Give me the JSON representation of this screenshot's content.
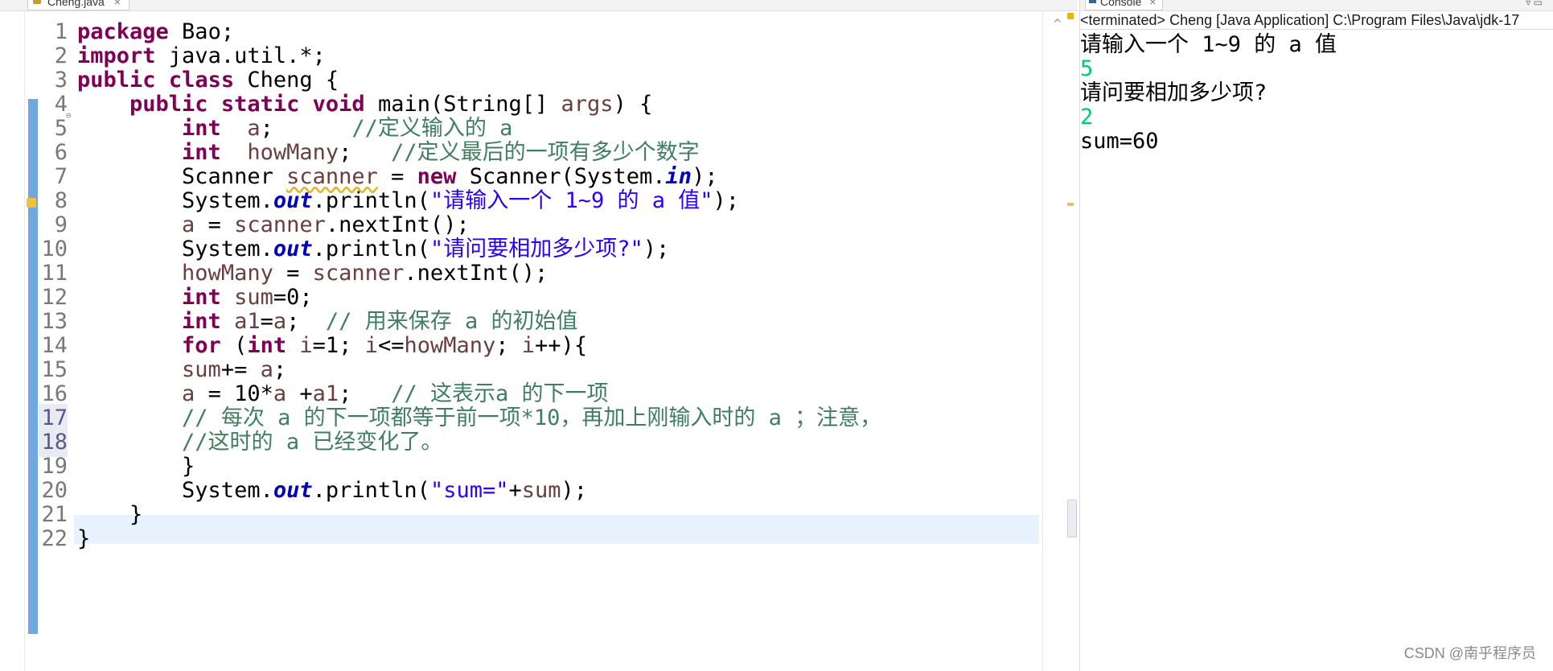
{
  "editor": {
    "tab_title": "Cheng.java",
    "tab_close": "×",
    "line_numbers": [
      "1",
      "2",
      "3",
      "4",
      "5",
      "6",
      "7",
      "8",
      "9",
      "10",
      "11",
      "12",
      "13",
      "14",
      "15",
      "16",
      "17",
      "18",
      "19",
      "20",
      "21",
      "22"
    ],
    "fold_marker": "⊖",
    "lines": [
      [
        {
          "t": "package",
          "c": "kw"
        },
        {
          "t": " Bao;"
        }
      ],
      [
        {
          "t": "import",
          "c": "kw"
        },
        {
          "t": " java.util.*;"
        }
      ],
      [
        {
          "t": "public",
          "c": "kw"
        },
        {
          "t": " "
        },
        {
          "t": "class",
          "c": "kw"
        },
        {
          "t": " Cheng {"
        }
      ],
      [
        {
          "t": "    "
        },
        {
          "t": "public",
          "c": "kw"
        },
        {
          "t": " "
        },
        {
          "t": "static",
          "c": "kw"
        },
        {
          "t": " "
        },
        {
          "t": "void",
          "c": "kw"
        },
        {
          "t": " main(String[] "
        },
        {
          "t": "args",
          "c": "var"
        },
        {
          "t": ") {"
        }
      ],
      [
        {
          "t": "        "
        },
        {
          "t": "int",
          "c": "kw"
        },
        {
          "t": "  "
        },
        {
          "t": "a",
          "c": "var"
        },
        {
          "t": ";      "
        },
        {
          "t": "//定义输入的 a",
          "c": "cm"
        }
      ],
      [
        {
          "t": "        "
        },
        {
          "t": "int",
          "c": "kw"
        },
        {
          "t": "  "
        },
        {
          "t": "howMany",
          "c": "var"
        },
        {
          "t": ";   "
        },
        {
          "t": "//定义最后的一项有多少个数字",
          "c": "cm"
        }
      ],
      [
        {
          "t": "        Scanner "
        },
        {
          "t": "scanner",
          "c": "warnvar"
        },
        {
          "t": " = "
        },
        {
          "t": "new",
          "c": "kw"
        },
        {
          "t": " Scanner(System."
        },
        {
          "t": "in",
          "c": "fld"
        },
        {
          "t": ");"
        }
      ],
      [
        {
          "t": "        System."
        },
        {
          "t": "out",
          "c": "fld"
        },
        {
          "t": ".println("
        },
        {
          "t": "\"请输入一个 1~9 的 a 值\"",
          "c": "str"
        },
        {
          "t": ");"
        }
      ],
      [
        {
          "t": "        "
        },
        {
          "t": "a",
          "c": "var"
        },
        {
          "t": " = "
        },
        {
          "t": "scanner",
          "c": "var"
        },
        {
          "t": ".nextInt();"
        }
      ],
      [
        {
          "t": "        System."
        },
        {
          "t": "out",
          "c": "fld"
        },
        {
          "t": ".println("
        },
        {
          "t": "\"请问要相加多少项?\"",
          "c": "str"
        },
        {
          "t": ");"
        }
      ],
      [
        {
          "t": "        "
        },
        {
          "t": "howMany",
          "c": "var"
        },
        {
          "t": " = "
        },
        {
          "t": "scanner",
          "c": "var"
        },
        {
          "t": ".nextInt();"
        }
      ],
      [
        {
          "t": "        "
        },
        {
          "t": "int",
          "c": "kw"
        },
        {
          "t": " "
        },
        {
          "t": "sum",
          "c": "var"
        },
        {
          "t": "=0;"
        }
      ],
      [
        {
          "t": "        "
        },
        {
          "t": "int",
          "c": "kw"
        },
        {
          "t": " "
        },
        {
          "t": "a1",
          "c": "var"
        },
        {
          "t": "="
        },
        {
          "t": "a",
          "c": "var"
        },
        {
          "t": ";  "
        },
        {
          "t": "// 用来保存 a 的初始值",
          "c": "cm"
        }
      ],
      [
        {
          "t": "        "
        },
        {
          "t": "for",
          "c": "kw"
        },
        {
          "t": " ("
        },
        {
          "t": "int",
          "c": "kw"
        },
        {
          "t": " "
        },
        {
          "t": "i",
          "c": "var"
        },
        {
          "t": "=1; "
        },
        {
          "t": "i",
          "c": "var"
        },
        {
          "t": "<="
        },
        {
          "t": "howMany",
          "c": "var"
        },
        {
          "t": "; "
        },
        {
          "t": "i",
          "c": "var"
        },
        {
          "t": "++){"
        }
      ],
      [
        {
          "t": "        "
        },
        {
          "t": "sum",
          "c": "var"
        },
        {
          "t": "+= "
        },
        {
          "t": "a",
          "c": "var"
        },
        {
          "t": ";"
        }
      ],
      [
        {
          "t": "        "
        },
        {
          "t": "a",
          "c": "var"
        },
        {
          "t": " = 10*"
        },
        {
          "t": "a",
          "c": "var"
        },
        {
          "t": " +"
        },
        {
          "t": "a1",
          "c": "var"
        },
        {
          "t": ";   "
        },
        {
          "t": "// 这表示a 的下一项",
          "c": "cm"
        }
      ],
      [
        {
          "t": "        "
        },
        {
          "t": "// 每次 a 的下一项都等于前一项*10，再加上刚输入时的 a ；注意，",
          "c": "cm"
        }
      ],
      [
        {
          "t": "        "
        },
        {
          "t": "//这时的 a 已经变化了。",
          "c": "cm"
        }
      ],
      [
        {
          "t": "        }"
        }
      ],
      [
        {
          "t": "        System."
        },
        {
          "t": "out",
          "c": "fld"
        },
        {
          "t": ".println("
        },
        {
          "t": "\"sum=\"",
          "c": "str"
        },
        {
          "t": "+"
        },
        {
          "t": "sum",
          "c": "var"
        },
        {
          "t": ");"
        }
      ],
      [
        {
          "t": "    }"
        }
      ],
      [
        {
          "t": "}"
        }
      ]
    ]
  },
  "console": {
    "tab_title": "Console",
    "tab_close": "×",
    "menu_glyph": "▿ ▭",
    "status": "<terminated> Cheng [Java Application] C:\\Program Files\\Java\\jdk-17",
    "output": [
      {
        "text": "请输入一个 1~9 的 a 值",
        "kind": "out"
      },
      {
        "text": "5",
        "kind": "in"
      },
      {
        "text": "请问要相加多少项?",
        "kind": "out"
      },
      {
        "text": "2",
        "kind": "in"
      },
      {
        "text": "sum=60",
        "kind": "out"
      }
    ]
  },
  "watermark": "CSDN @南乎程序员",
  "colors": {
    "keyword": "#7f0055",
    "string": "#2a00ff",
    "comment": "#3f7f5f",
    "field": "#0000c0",
    "local_var": "#6a3e3e",
    "stdin": "#00c87d",
    "current_line": "#e8f2fe",
    "change_bar": "#6fa9df"
  }
}
